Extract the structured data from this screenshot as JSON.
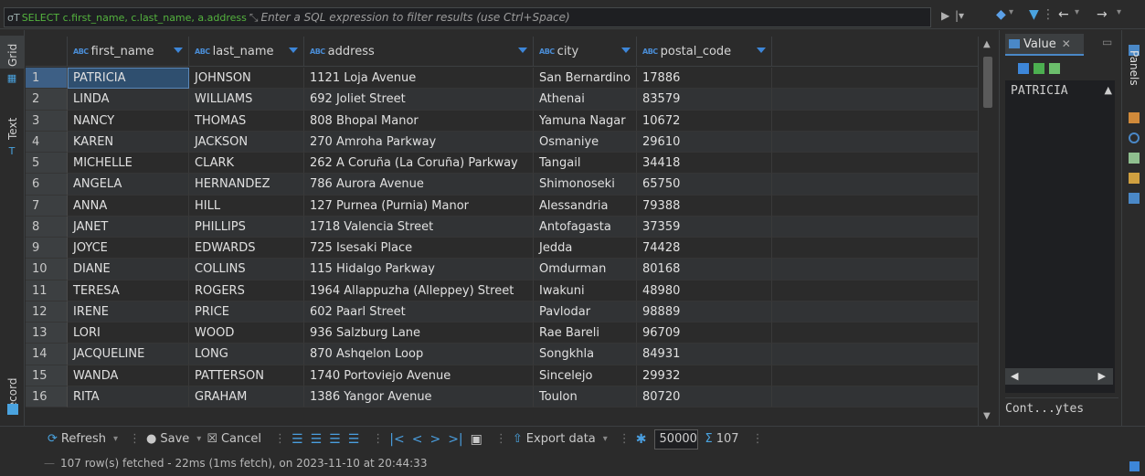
{
  "filter": {
    "query": "SELECT c.first_name, c.last_name, a.address",
    "placeholder": "Enter a SQL expression to filter results (use Ctrl+Space)"
  },
  "side_tabs": {
    "grid": "Grid",
    "text": "Text",
    "record": "Record"
  },
  "columns": [
    {
      "type": "ABC",
      "name": "first_name"
    },
    {
      "type": "ABC",
      "name": "last_name"
    },
    {
      "type": "ABC",
      "name": "address"
    },
    {
      "type": "ABC",
      "name": "city"
    },
    {
      "type": "ABC",
      "name": "postal_code"
    }
  ],
  "rows": [
    [
      "1",
      "PATRICIA",
      "JOHNSON",
      "1121 Loja Avenue",
      "San Bernardino",
      "17886"
    ],
    [
      "2",
      "LINDA",
      "WILLIAMS",
      "692 Joliet Street",
      "Athenai",
      "83579"
    ],
    [
      "3",
      "NANCY",
      "THOMAS",
      "808 Bhopal Manor",
      "Yamuna Nagar",
      "10672"
    ],
    [
      "4",
      "KAREN",
      "JACKSON",
      "270 Amroha Parkway",
      "Osmaniye",
      "29610"
    ],
    [
      "5",
      "MICHELLE",
      "CLARK",
      "262 A Coruña (La Coruña) Parkway",
      "Tangail",
      "34418"
    ],
    [
      "6",
      "ANGELA",
      "HERNANDEZ",
      "786 Aurora Avenue",
      "Shimonoseki",
      "65750"
    ],
    [
      "7",
      "ANNA",
      "HILL",
      "127 Purnea (Purnia) Manor",
      "Alessandria",
      "79388"
    ],
    [
      "8",
      "JANET",
      "PHILLIPS",
      "1718 Valencia Street",
      "Antofagasta",
      "37359"
    ],
    [
      "9",
      "JOYCE",
      "EDWARDS",
      "725 Isesaki Place",
      "Jedda",
      "74428"
    ],
    [
      "10",
      "DIANE",
      "COLLINS",
      "115 Hidalgo Parkway",
      "Omdurman",
      "80168"
    ],
    [
      "11",
      "TERESA",
      "ROGERS",
      "1964 Allappuzha (Alleppey) Street",
      "Iwakuni",
      "48980"
    ],
    [
      "12",
      "IRENE",
      "PRICE",
      "602 Paarl Street",
      "Pavlodar",
      "98889"
    ],
    [
      "13",
      "LORI",
      "WOOD",
      "936 Salzburg Lane",
      "Rae Bareli",
      "96709"
    ],
    [
      "14",
      "JACQUELINE",
      "LONG",
      "870 Ashqelon Loop",
      "Songkhla",
      "84931"
    ],
    [
      "15",
      "WANDA",
      "PATTERSON",
      "1740 Portoviejo Avenue",
      "Sincelejo",
      "29932"
    ],
    [
      "16",
      "RITA",
      "GRAHAM",
      "1386 Yangor Avenue",
      "Toulon",
      "80720"
    ]
  ],
  "value_panel": {
    "tab_label": "Value",
    "value": "PATRICIA",
    "status": "Cont...ytes"
  },
  "right_strip": {
    "panels_label": "Panels"
  },
  "toolbar": {
    "refresh": "Refresh",
    "save": "Save",
    "cancel": "Cancel",
    "export": "Export data",
    "fetch_size": "50000",
    "row_count": "107"
  },
  "status": "107 row(s) fetched - 22ms (1ms fetch), on 2023-11-10 at 20:44:33",
  "colors": {
    "accent": "#3d86d8",
    "query_green": "#54b33e",
    "bg": "#2b2b2b"
  }
}
